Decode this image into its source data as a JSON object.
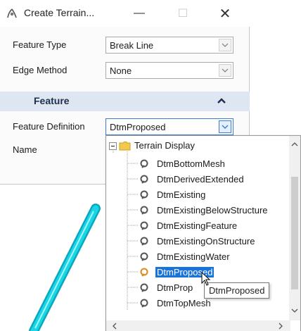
{
  "window": {
    "title": "Create Terrain...",
    "minimize_glyph": "—",
    "maximize_glyph": "☐",
    "close_glyph": "✕"
  },
  "fields": {
    "feature_type": {
      "label": "Feature Type",
      "value": "Break Line"
    },
    "edge_method": {
      "label": "Edge Method",
      "value": "None"
    }
  },
  "section": {
    "title": "Feature",
    "collapsed": false
  },
  "feature_fields": {
    "feature_definition": {
      "label": "Feature Definition",
      "value": "DtmProposed"
    },
    "name": {
      "label": "Name"
    }
  },
  "tree": {
    "root": "Terrain Display",
    "items": [
      {
        "label": "DtmBottomMesh",
        "selected": false
      },
      {
        "label": "DtmDerivedExtended",
        "selected": false
      },
      {
        "label": "DtmExisting",
        "selected": false
      },
      {
        "label": "DtmExistingBelowStructure",
        "selected": false
      },
      {
        "label": "DtmExistingFeature",
        "selected": false
      },
      {
        "label": "DtmExistingOnStructure",
        "selected": false
      },
      {
        "label": "DtmExistingWater",
        "selected": false
      },
      {
        "label": "DtmProposed",
        "selected": true
      },
      {
        "label": "DtmProp",
        "selected": false
      },
      {
        "label": "DtmTopMesh",
        "selected": false
      }
    ]
  },
  "tooltip": "DtmProposed",
  "colors": {
    "selection": "#1a73d9",
    "section_header": "#dde6f2",
    "canvas_line": "#19d6e6",
    "folder": "#f2c94c"
  }
}
